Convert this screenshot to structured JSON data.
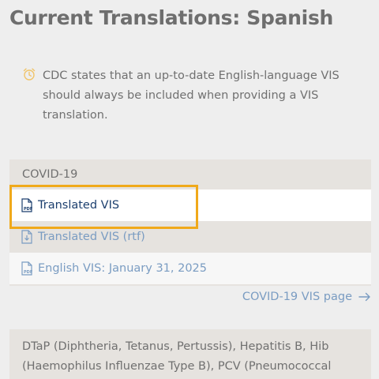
{
  "page": {
    "title": "Current Translations: Spanish"
  },
  "note": {
    "icon": "alarm-clock-icon",
    "text": "CDC states that an up-to-date English-language VIS should always be included when providing a VIS translation."
  },
  "covid_card": {
    "heading": "COVID-19",
    "links": [
      {
        "label": "Translated VIS",
        "icon": "pdf-icon"
      },
      {
        "label": "Translated VIS (rtf)",
        "icon": "rtf-icon"
      },
      {
        "label": "English VIS: January 31, 2025",
        "icon": "pdf-icon"
      }
    ],
    "page_link": "COVID-19 VIS page"
  },
  "dtap_card": {
    "heading": "DTaP (Diphtheria, Tetanus, Pertussis), Hepatitis B, Hib (Haemophilus Influenzae Type B), PCV (Pneumococcal Conjugate), and Polio"
  },
  "colors": {
    "accent_focus": "#f0a91a",
    "link": "#7a9cc2",
    "link_active": "#1c3f6e"
  }
}
